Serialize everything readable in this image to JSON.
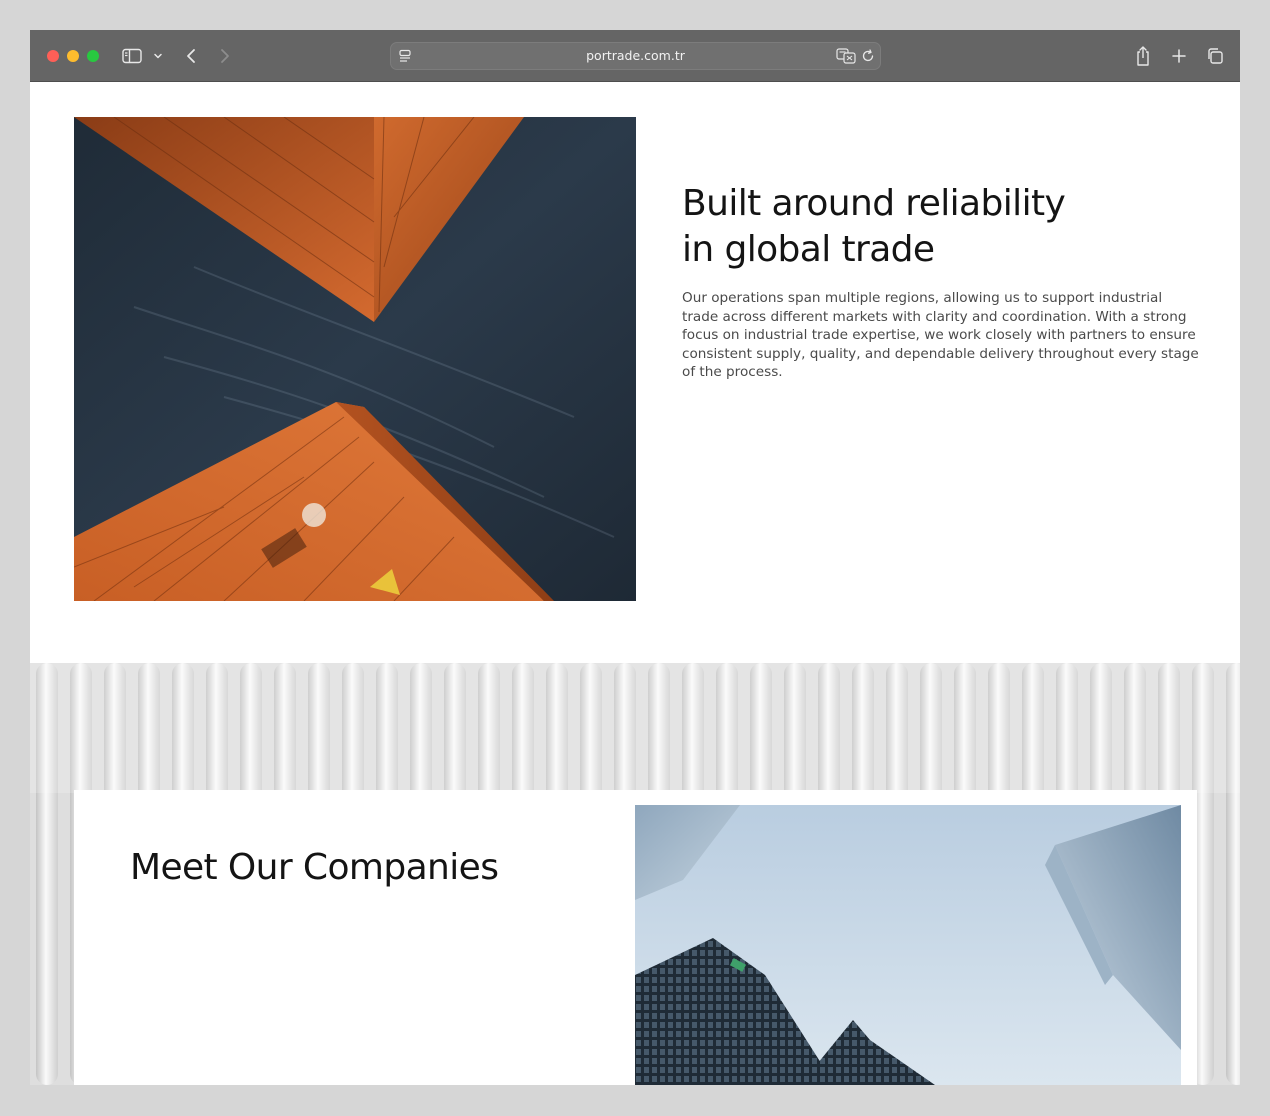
{
  "browser": {
    "url": "portrade.com.tr"
  },
  "about": {
    "title_line1": "Built around reliability",
    "title_line2": "in global trade",
    "body": "Our operations span multiple regions, allowing us to support industrial trade across different markets with clarity and coordination. With a strong focus on industrial trade expertise, we work closely with partners to ensure consistent supply, quality, and dependable delivery throughout every stage of the process."
  },
  "companies": {
    "title": "Meet Our Companies"
  },
  "colors": {
    "toolbar": "#656565",
    "container_orange": "#c9602a",
    "sky_navy": "#233140"
  },
  "icons": [
    "sidebar-icon",
    "chevron-down-icon",
    "back-arrow-icon",
    "forward-arrow-icon",
    "page-menu-icon",
    "translate-icon",
    "reload-icon",
    "share-icon",
    "plus-icon",
    "tabs-icon"
  ]
}
